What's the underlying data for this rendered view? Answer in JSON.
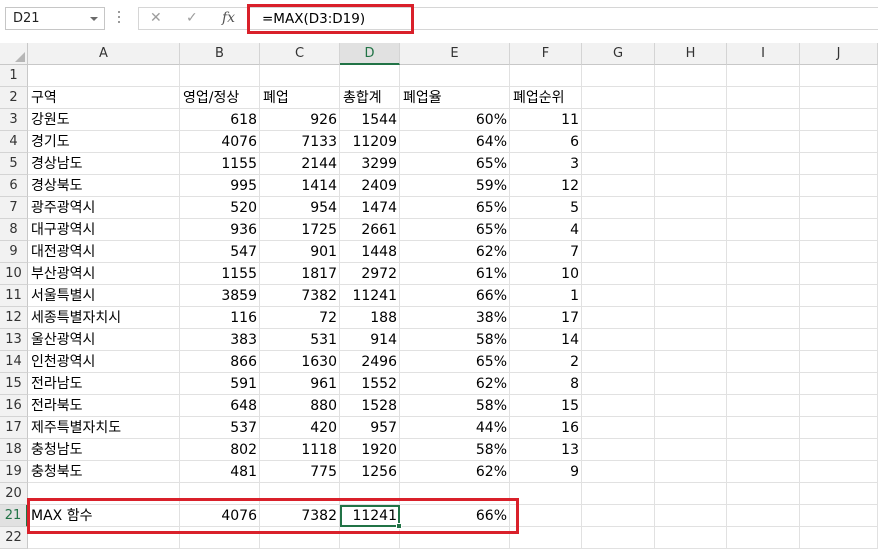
{
  "formula_bar": {
    "name_box": "D21",
    "cancel_glyph": "✕",
    "enter_glyph": "✓",
    "fx_label": "fx",
    "formula": "=MAX(D3:D19)"
  },
  "columns": [
    "A",
    "B",
    "C",
    "D",
    "E",
    "F",
    "G",
    "H",
    "I",
    "J"
  ],
  "rows": [
    "1",
    "2",
    "3",
    "4",
    "5",
    "6",
    "7",
    "8",
    "9",
    "10",
    "11",
    "12",
    "13",
    "14",
    "15",
    "16",
    "17",
    "18",
    "19",
    "20",
    "21",
    "22"
  ],
  "headers": [
    "구역",
    "영업/정상",
    "폐업",
    "총합계",
    "폐업율",
    "폐업순위"
  ],
  "table": [
    [
      "강원도",
      "618",
      "926",
      "1544",
      "60%",
      "11"
    ],
    [
      "경기도",
      "4076",
      "7133",
      "11209",
      "64%",
      "6"
    ],
    [
      "경상남도",
      "1155",
      "2144",
      "3299",
      "65%",
      "3"
    ],
    [
      "경상북도",
      "995",
      "1414",
      "2409",
      "59%",
      "12"
    ],
    [
      "광주광역시",
      "520",
      "954",
      "1474",
      "65%",
      "5"
    ],
    [
      "대구광역시",
      "936",
      "1725",
      "2661",
      "65%",
      "4"
    ],
    [
      "대전광역시",
      "547",
      "901",
      "1448",
      "62%",
      "7"
    ],
    [
      "부산광역시",
      "1155",
      "1817",
      "2972",
      "61%",
      "10"
    ],
    [
      "서울특별시",
      "3859",
      "7382",
      "11241",
      "66%",
      "1"
    ],
    [
      "세종특별자치시",
      "116",
      "72",
      "188",
      "38%",
      "17"
    ],
    [
      "울산광역시",
      "383",
      "531",
      "914",
      "58%",
      "14"
    ],
    [
      "인천광역시",
      "866",
      "1630",
      "2496",
      "65%",
      "2"
    ],
    [
      "전라남도",
      "591",
      "961",
      "1552",
      "62%",
      "8"
    ],
    [
      "전라북도",
      "648",
      "880",
      "1528",
      "58%",
      "15"
    ],
    [
      "제주특별자치도",
      "537",
      "420",
      "957",
      "44%",
      "16"
    ],
    [
      "충청남도",
      "802",
      "1118",
      "1920",
      "58%",
      "13"
    ],
    [
      "충청북도",
      "481",
      "775",
      "1256",
      "62%",
      "9"
    ]
  ],
  "max_row": [
    "MAX 함수",
    "4076",
    "7382",
    "11241",
    "66%"
  ],
  "colors": {
    "highlight_red": "#d9202a",
    "excel_green": "#217346"
  },
  "selected_cell": "D21"
}
